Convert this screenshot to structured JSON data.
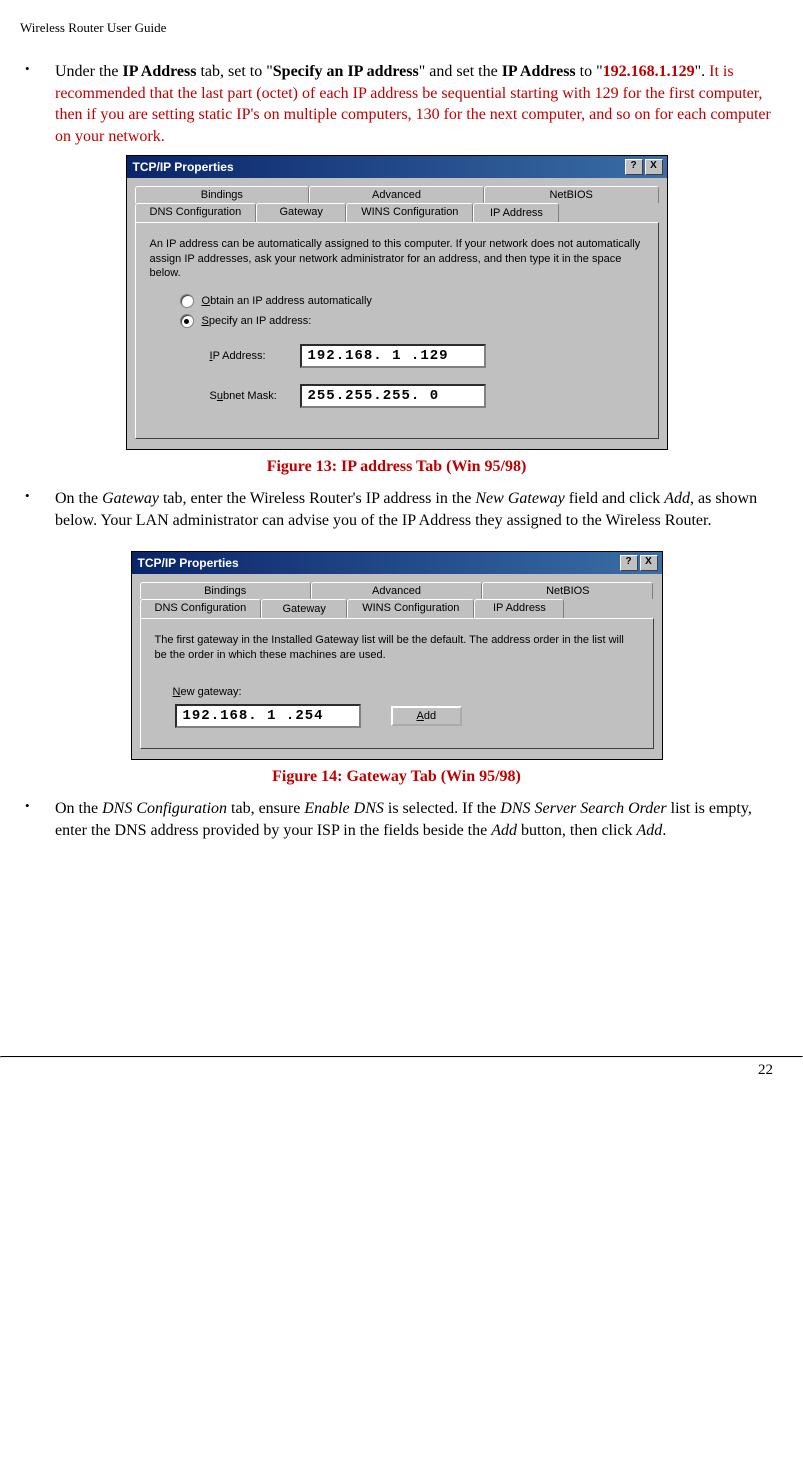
{
  "header": "Wireless Router User Guide",
  "bullet1": {
    "t1": "Under the ",
    "bold1": "IP Address",
    "t2": " tab, set to \"",
    "bold2": "Specify an IP address",
    "t3": "\" and set the ",
    "bold3": "IP Address",
    "t4": " to \"",
    "redbold": "192.168.1.129",
    "t5": "\".  ",
    "redtext": "It is recommended that the last part (octet) of each IP address be sequential starting with 129 for the first computer, then if you are setting static IP's on multiple computers, 130 for the next computer, and so on for each computer on your network."
  },
  "dialog1": {
    "title": "TCP/IP Properties",
    "help": "?",
    "close": "X",
    "tabs_row1": {
      "t1": "Bindings",
      "t2": "Advanced",
      "t3": "NetBIOS"
    },
    "tabs_row2": {
      "t1": "DNS Configuration",
      "t2": "Gateway",
      "t3": "WINS Configuration",
      "t4": "IP Address"
    },
    "panel_text": "An IP address can be automatically assigned to this computer. If your network does not automatically assign IP addresses, ask your network administrator for an address, and then type it in the space below.",
    "radio1_u": "O",
    "radio1_rest": "btain an IP address automatically",
    "radio2_u": "S",
    "radio2_rest": "pecify an IP address:",
    "ip_label_u": "I",
    "ip_label_rest": "P Address:",
    "subnet_label": "S",
    "subnet_u": "u",
    "subnet_rest": "bnet Mask:",
    "ip_value": "192.168. 1 .129",
    "subnet_value": "255.255.255. 0"
  },
  "caption1": "Figure 13: IP address Tab (Win 95/98)",
  "bullet2": {
    "t1": "On the ",
    "it1": "Gateway",
    "t2": " tab, enter the Wireless Router's IP address in the ",
    "it2": "New Gateway",
    "t3": " field and click ",
    "it3": "Add",
    "t4": ", as shown below. Your LAN administrator can advise you of the IP Address they assigned to the Wireless Router."
  },
  "dialog2": {
    "title": "TCP/IP Properties",
    "help": "?",
    "close": "X",
    "tabs_row1": {
      "t1": "Bindings",
      "t2": "Advanced",
      "t3": "NetBIOS"
    },
    "tabs_row2": {
      "t1": "DNS Configuration",
      "t2": "Gateway",
      "t3": "WINS Configuration",
      "t4": "IP Address"
    },
    "panel_text": "The first gateway in the Installed Gateway list will be the default. The address order in the list will be the order in which these machines are used.",
    "ng_u": "N",
    "ng_rest": "ew gateway:",
    "gw_value": "192.168. 1 .254",
    "add_u": "A",
    "add_rest": "dd"
  },
  "caption2": "Figure 14: Gateway Tab (Win 95/98)",
  "bullet3": {
    "t1": "On the ",
    "it1": "DNS Configuration",
    "t2": " tab, ensure ",
    "it2": "Enable DNS",
    "t3": " is selected. If the ",
    "it3": "DNS Server Search Order",
    "t4": " list is empty, enter the DNS address provided by your ISP in the fields beside the ",
    "it4": "Add",
    "t5": " button, then click ",
    "it5": "Add",
    "t6": "."
  },
  "page_number": "22"
}
